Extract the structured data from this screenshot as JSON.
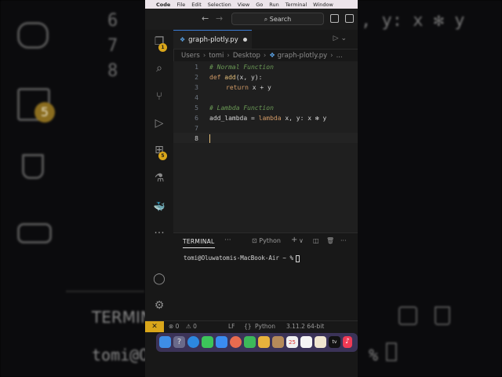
{
  "background": {
    "line_numbers": [
      "6",
      "7",
      "8"
    ],
    "code_fragment": ", y: x ✻ y",
    "badge": "5",
    "terminal_label": "TERMIN",
    "terminal_prompt": "tomi@O",
    "prompt_tail": "%"
  },
  "menubar": {
    "apple": "",
    "app": "Code",
    "items": [
      "File",
      "Edit",
      "Selection",
      "View",
      "Go",
      "Run",
      "Terminal",
      "Window"
    ]
  },
  "titlebar": {
    "back": "←",
    "forward": "→",
    "search_icon": "search-icon",
    "search_label": "Search"
  },
  "activity_bar": {
    "items": [
      {
        "name": "explorer-icon",
        "glyph": "❐"
      },
      {
        "name": "search-icon",
        "glyph": "⌕"
      },
      {
        "name": "source-control-icon",
        "glyph": "⑂"
      },
      {
        "name": "run-debug-icon",
        "glyph": "▷"
      },
      {
        "name": "extensions-icon",
        "glyph": "⊞"
      },
      {
        "name": "testing-icon",
        "glyph": "⚗"
      },
      {
        "name": "docker-icon",
        "glyph": "🐳"
      },
      {
        "name": "more-icon",
        "glyph": "···"
      },
      {
        "name": "account-icon",
        "glyph": "◯"
      },
      {
        "name": "settings-gear-icon",
        "glyph": "⚙"
      }
    ],
    "explorer_badge": "1",
    "extensions_badge": "5"
  },
  "tab": {
    "file_name": "graph-plotly.py",
    "file_icon": "python-file-icon"
  },
  "breadcrumb": {
    "parts": [
      "Users",
      "tomi",
      "Desktop",
      "graph-plotly.py",
      "..."
    ]
  },
  "editor": {
    "line_numbers": [
      "1",
      "2",
      "3",
      "4",
      "5",
      "6",
      "7",
      "8"
    ],
    "current_line": 8,
    "lines": {
      "l1_comment": "# Normal Function",
      "l2_def": "def ",
      "l2_name": "add",
      "l2_params": "(x, y):",
      "l3_return": "return",
      "l3_expr": " x + y",
      "l5_comment": "# Lambda Function",
      "l6_var": "add_lambda = ",
      "l6_lambda": "lambda",
      "l6_rest": " x, y: x ✻ y"
    }
  },
  "panel": {
    "tab_label": "TERMINAL",
    "more": "···",
    "shell_label": "Python",
    "add": "+",
    "chevron": "∨",
    "prompt": "tomi@Oluwatomis-MacBook-Air ~ %"
  },
  "statusbar": {
    "remote_icon": "remote-icon",
    "errors": "⊗ 0",
    "warnings": "⚠ 0",
    "eol": "LF",
    "language_icon": "braces-icon",
    "language": "Python",
    "interpreter": "3.11.2 64-bit"
  },
  "colors": {
    "accent": "#d9a61a",
    "tab_border": "#3a7bd5",
    "comment": "#6a9955",
    "keyword": "#d19a66",
    "function": "#e5c07b",
    "dock": "#3b3358"
  },
  "dock": {
    "apps": [
      {
        "name": "finder-icon",
        "color": "#3e8ee6"
      },
      {
        "name": "help-icon",
        "color": "#6a6a8a"
      },
      {
        "name": "safari-icon",
        "color": "#2c88e0"
      },
      {
        "name": "messages-icon",
        "color": "#3cc45a"
      },
      {
        "name": "mail-icon",
        "color": "#3a8cf0"
      },
      {
        "name": "photos-icon",
        "color": "#e86b4f"
      },
      {
        "name": "facetime-icon",
        "color": "#3cb85a"
      },
      {
        "name": "notes-icon",
        "color": "#e8b23c"
      },
      {
        "name": "contacts-icon",
        "color": "#b58a5a"
      },
      {
        "name": "calendar-icon",
        "color": "#f0f0f0"
      },
      {
        "name": "reminders-icon",
        "color": "#f5f5f5"
      },
      {
        "name": "freeform-icon",
        "color": "#f0e6d0"
      },
      {
        "name": "tv-icon",
        "color": "#111111"
      },
      {
        "name": "music-icon",
        "color": "#f03a55"
      }
    ],
    "calendar_day": "25",
    "tv_label": "tv",
    "music_glyph": "♪"
  }
}
